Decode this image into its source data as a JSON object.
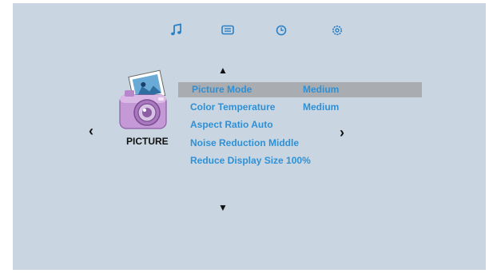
{
  "top_tabs": [
    {
      "icon": "music-note-icon"
    },
    {
      "icon": "display-icon"
    },
    {
      "icon": "clock-icon"
    },
    {
      "icon": "settings-icon"
    }
  ],
  "category": {
    "label": "PICTURE",
    "icon": "camera-icon"
  },
  "nav": {
    "up": "▲",
    "down": "▼",
    "left": "‹",
    "right": "›"
  },
  "menu": {
    "items": [
      {
        "label": "Picture Mode",
        "value": "Medium",
        "selected": true
      },
      {
        "label": "Color Temperature",
        "value": "Medium"
      },
      {
        "label": "Aspect Ratio Auto",
        "value": ""
      },
      {
        "label": "Noise Reduction Middle",
        "value": ""
      },
      {
        "label": "Reduce Display Size 100%",
        "value": ""
      }
    ]
  },
  "colors": {
    "background": "#c9d6e1",
    "selection": "#a9adb1",
    "menu_text": "#2e90d6",
    "icon": "#2a7fc5"
  }
}
